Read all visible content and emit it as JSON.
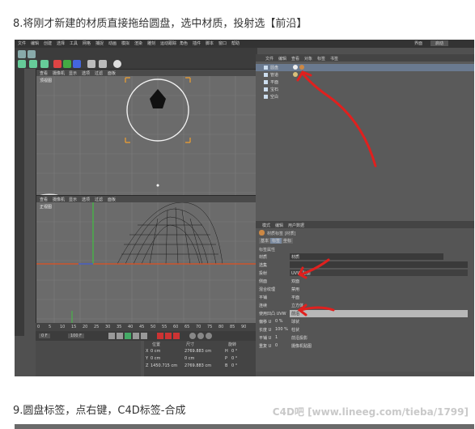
{
  "captions": {
    "step8": "8.将刚才新建的材质直接拖给圆盘，选中材质，投射选【前沿】",
    "step9": "9.圆盘标签，点右键，C4D标签-合成"
  },
  "watermark": "C4D吧 [www.lineeg.com/tieba/1799]",
  "app": {
    "main_menu": [
      "文件",
      "编辑",
      "创建",
      "选择",
      "工具",
      "网格",
      "捕捉",
      "动画",
      "模拟",
      "渲染",
      "雕刻",
      "运动跟踪",
      "角色",
      "插件",
      "脚本",
      "窗口",
      "帮助"
    ],
    "layout_label": "界面",
    "layout_value": "启动",
    "viewport_menu": [
      "查看",
      "摄像机",
      "显示",
      "选项",
      "过滤",
      "面板"
    ],
    "viewport_top_label": "顶视图",
    "viewport_front_label": "正视图"
  },
  "object_manager": {
    "menu": [
      "文件",
      "编辑",
      "查看",
      "对象",
      "标签",
      "书签"
    ],
    "objects": [
      {
        "name": "圆盘",
        "selected": true
      },
      {
        "name": "管道"
      },
      {
        "name": "平面"
      },
      {
        "name": "宝石"
      },
      {
        "name": "空白"
      }
    ]
  },
  "attribute_manager": {
    "menu": [
      "模式",
      "编辑",
      "用户数据"
    ],
    "tag_title": "材质标签 [材质]",
    "tabs": [
      "基本",
      "标签",
      "坐标"
    ],
    "section": "标签属性",
    "fields": [
      {
        "label": "材质",
        "value": "材质"
      },
      {
        "label": "选集",
        "value": ""
      },
      {
        "label": "投射",
        "value": "UVW 贴图"
      },
      {
        "label": "侧面",
        "value": "双面"
      },
      {
        "label": "混合纹理",
        "value": "禁用"
      },
      {
        "label": "平铺",
        "value": "平面"
      },
      {
        "label": "连续",
        "value": "立方体"
      },
      {
        "label": "使用凹凸 UVW",
        "value": "前沿"
      },
      {
        "label": "偏移 U",
        "value": "0 %",
        "extra": "球状"
      },
      {
        "label": "长度 U",
        "value": "100 %",
        "extra": "柱状"
      },
      {
        "label": "平铺 U",
        "value": "1",
        "extra": "前沿投影"
      },
      {
        "label": "重复 U",
        "value": "0",
        "extra": "摄像机贴图"
      }
    ]
  },
  "timeline": {
    "ticks": [
      "0",
      "5",
      "10",
      "15",
      "20",
      "25",
      "30",
      "35",
      "40",
      "45",
      "50",
      "55",
      "60",
      "65",
      "70",
      "75",
      "80",
      "85",
      "90"
    ],
    "current_frame": "0 F",
    "end_frame": "100 F"
  },
  "coordinates": {
    "headers": [
      "位置",
      "尺寸",
      "旋转"
    ],
    "rows": [
      {
        "axis": "X",
        "pos": "0 cm",
        "size": "2769.883 cm",
        "rot_label": "H",
        "rot": "0 °"
      },
      {
        "axis": "Y",
        "pos": "0 cm",
        "size": "0 cm",
        "rot_label": "P",
        "rot": "0 °"
      },
      {
        "axis": "Z",
        "pos": "1450.715 cm",
        "size": "2769.883 cm",
        "rot_label": "B",
        "rot": "0 °"
      }
    ]
  },
  "colors": {
    "annotation": "#e0201e",
    "selection": "#f0a030",
    "axis_x": "#e05020",
    "axis_y": "#40c040",
    "axis_z": "#3060e0"
  }
}
